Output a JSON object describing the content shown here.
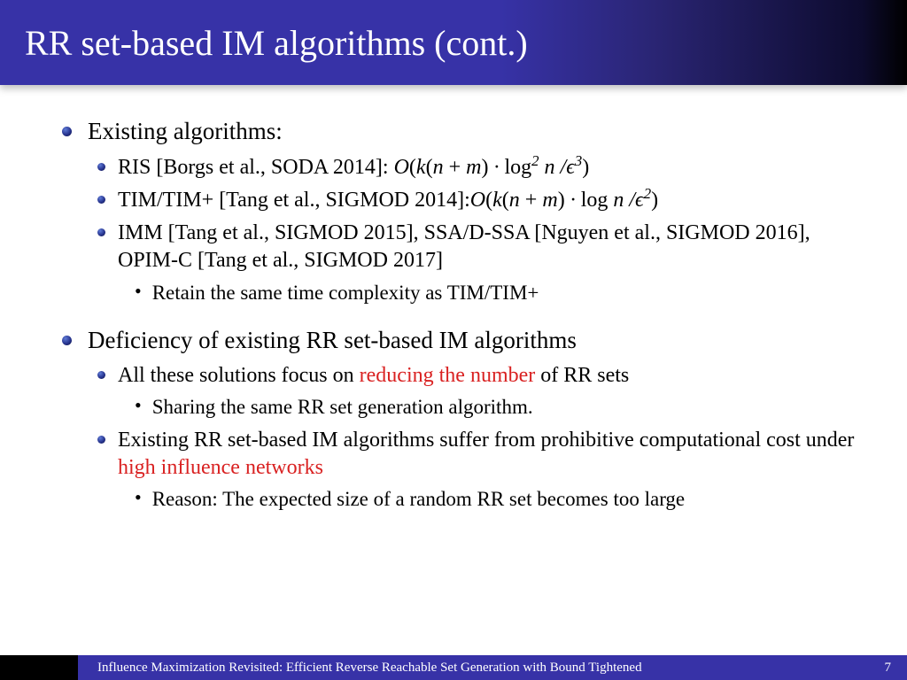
{
  "title": "RR set-based IM algorithms (cont.)",
  "sections": [
    {
      "heading": "Existing algorithms:",
      "items": [
        {
          "prefix": "RIS [Borgs et al., SODA 2014]: ",
          "math_html": "<span class='math'>O<span class='up'>(</span>k<span class='up'>(</span>n <span class='up'>+</span> m<span class='up'>)</span> · <span class='up'>log</span><sup>2</sup> n /ϵ<sup>3</sup><span class='up'>)</span></span>"
        },
        {
          "prefix": "TIM/TIM+ [Tang et al., SIGMOD 2014]:",
          "math_html": "<span class='math'>O<span class='up'>(</span>k<span class='up'>(</span>n <span class='up'>+</span> m<span class='up'>)</span> · <span class='up'>log</span> n /ϵ<sup>2</sup><span class='up'>)</span></span>"
        },
        {
          "text": "IMM [Tang et al., SIGMOD 2015], SSA/D-SSA [Nguyen et al., SIGMOD 2016], OPIM-C [Tang et al., SIGMOD 2017]",
          "sub": [
            {
              "text": "Retain the same time complexity as TIM/TIM+"
            }
          ]
        }
      ]
    },
    {
      "heading": "Deficiency of existing RR set-based IM algorithms",
      "items": [
        {
          "html": "All these solutions focus on <span class='highlight'>reducing the number</span> of RR sets",
          "sub": [
            {
              "text": "Sharing the same RR set generation algorithm."
            }
          ]
        },
        {
          "html": "Existing RR set-based IM algorithms suffer from prohibitive computational cost under <span class='highlight'>high influence networks</span>",
          "sub": [
            {
              "text": "Reason: The expected size of a random RR set becomes too large"
            }
          ]
        }
      ]
    }
  ],
  "footer": {
    "title": "Influence Maximization Revisited: Efficient Reverse Reachable Set Generation with Bound Tightened",
    "page": "7"
  }
}
